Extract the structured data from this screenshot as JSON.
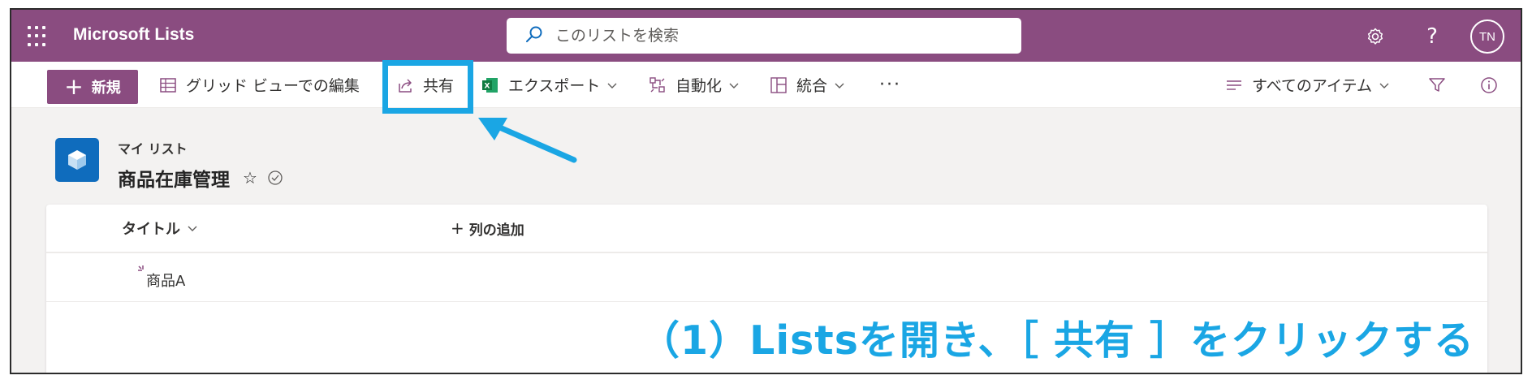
{
  "suitebar": {
    "app_title": "Microsoft Lists",
    "search_placeholder": "このリストを検索",
    "help_label": "?",
    "avatar_initials": "TN",
    "color": "#8a4c80"
  },
  "toolbar": {
    "new_label": "新規",
    "grid_edit_label": "グリッド ビューでの編集",
    "share_label": "共有",
    "export_label": "エクスポート",
    "automate_label": "自動化",
    "integrate_label": "統合",
    "more_label": "···",
    "view_label": "すべてのアイテム"
  },
  "list": {
    "breadcrumb": "マイ リスト",
    "title": "商品在庫管理",
    "favorite_icon": "☆"
  },
  "grid": {
    "columns": [
      "タイトル",
      "列の追加"
    ],
    "rows": [
      {
        "title": "商品A"
      }
    ]
  },
  "annotation": {
    "text": "（1）Listsを開き、［ 共有 ］をクリックする",
    "color": "#1aa6e4"
  }
}
